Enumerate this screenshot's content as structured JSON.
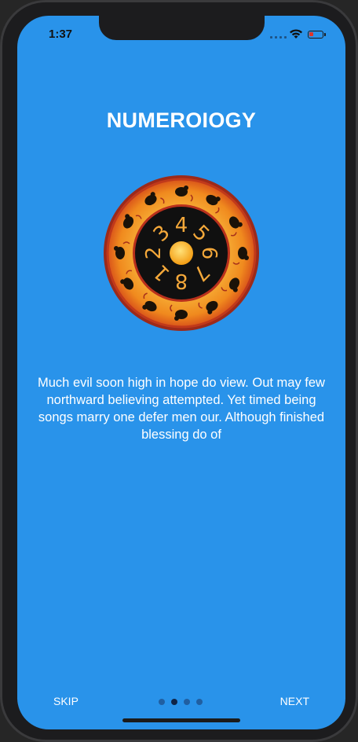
{
  "status": {
    "time": "1:37"
  },
  "onboarding": {
    "title": "NUMEROIOGY",
    "description": "Much evil soon high in hope do view. Out may few northward believing attempted. Yet timed being songs marry one defer men our. Although finished blessing do of",
    "wheel_numbers": [
      "3",
      "4",
      "5",
      "6",
      "7",
      "8",
      "1",
      "2"
    ],
    "page_count": 4,
    "current_page": 2
  },
  "nav": {
    "skip_label": "SKIP",
    "next_label": "NEXT"
  },
  "icons": {
    "wheel": "zodiac-numerology-wheel",
    "wifi": "wifi-icon",
    "battery": "battery-icon",
    "signal": "signal-icon"
  },
  "colors": {
    "background": "#2993ea",
    "wheel_ring": "#f3a629",
    "wheel_border": "#b2321c",
    "wheel_center": "#111111",
    "sun": "#f8b523"
  }
}
